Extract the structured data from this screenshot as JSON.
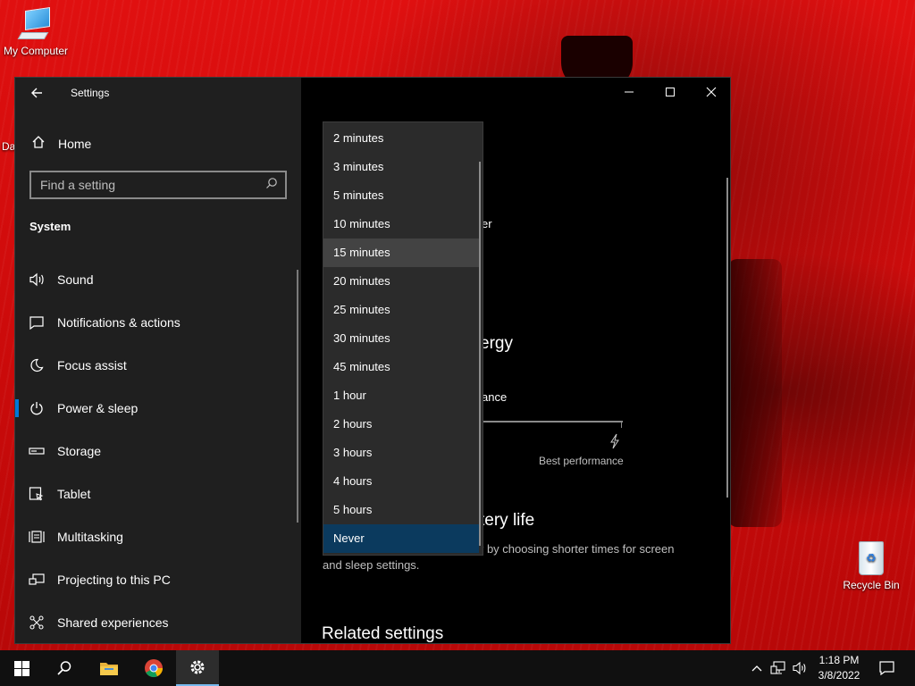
{
  "desktop": {
    "icons": [
      {
        "name": "my-computer",
        "label": "My Computer"
      },
      {
        "name": "recycle-bin",
        "label": "Recycle Bin"
      }
    ],
    "partial_label": "Da"
  },
  "window": {
    "title": "Settings",
    "home_label": "Home",
    "search_placeholder": "Find a setting",
    "section": "System",
    "nav_items": [
      {
        "label": "Sound",
        "icon": "speaker-icon"
      },
      {
        "label": "Notifications & actions",
        "icon": "notification-icon"
      },
      {
        "label": "Focus assist",
        "icon": "moon-icon"
      },
      {
        "label": "Power & sleep",
        "icon": "power-icon",
        "active": true
      },
      {
        "label": "Storage",
        "icon": "storage-icon"
      },
      {
        "label": "Tablet",
        "icon": "tablet-icon"
      },
      {
        "label": "Multitasking",
        "icon": "multitasking-icon"
      },
      {
        "label": "Projecting to this PC",
        "icon": "projecting-icon"
      },
      {
        "label": "Shared experiences",
        "icon": "shared-icon"
      }
    ],
    "content_fragments": {
      "frag_er": "er",
      "frag_ergy": "ergy",
      "frag_ance": "ance",
      "best_performance": "Best performance",
      "frag_tery_life": "tery life",
      "frag_battery_desc1": "r by choosing shorter times for screen",
      "frag_battery_desc2": "and sleep settings.",
      "related_settings": "Related settings"
    }
  },
  "dropdown": {
    "options": [
      "2 minutes",
      "3 minutes",
      "5 minutes",
      "10 minutes",
      "15 minutes",
      "20 minutes",
      "25 minutes",
      "30 minutes",
      "45 minutes",
      "1 hour",
      "2 hours",
      "3 hours",
      "4 hours",
      "5 hours",
      "Never"
    ],
    "hovered": "15 minutes",
    "selected": "Never"
  },
  "taskbar": {
    "time": "1:18 PM",
    "date": "3/8/2022"
  },
  "colors": {
    "accent": "#0078d7",
    "selected_option": "#0b3a5e",
    "desktop": "#d30d0d"
  }
}
